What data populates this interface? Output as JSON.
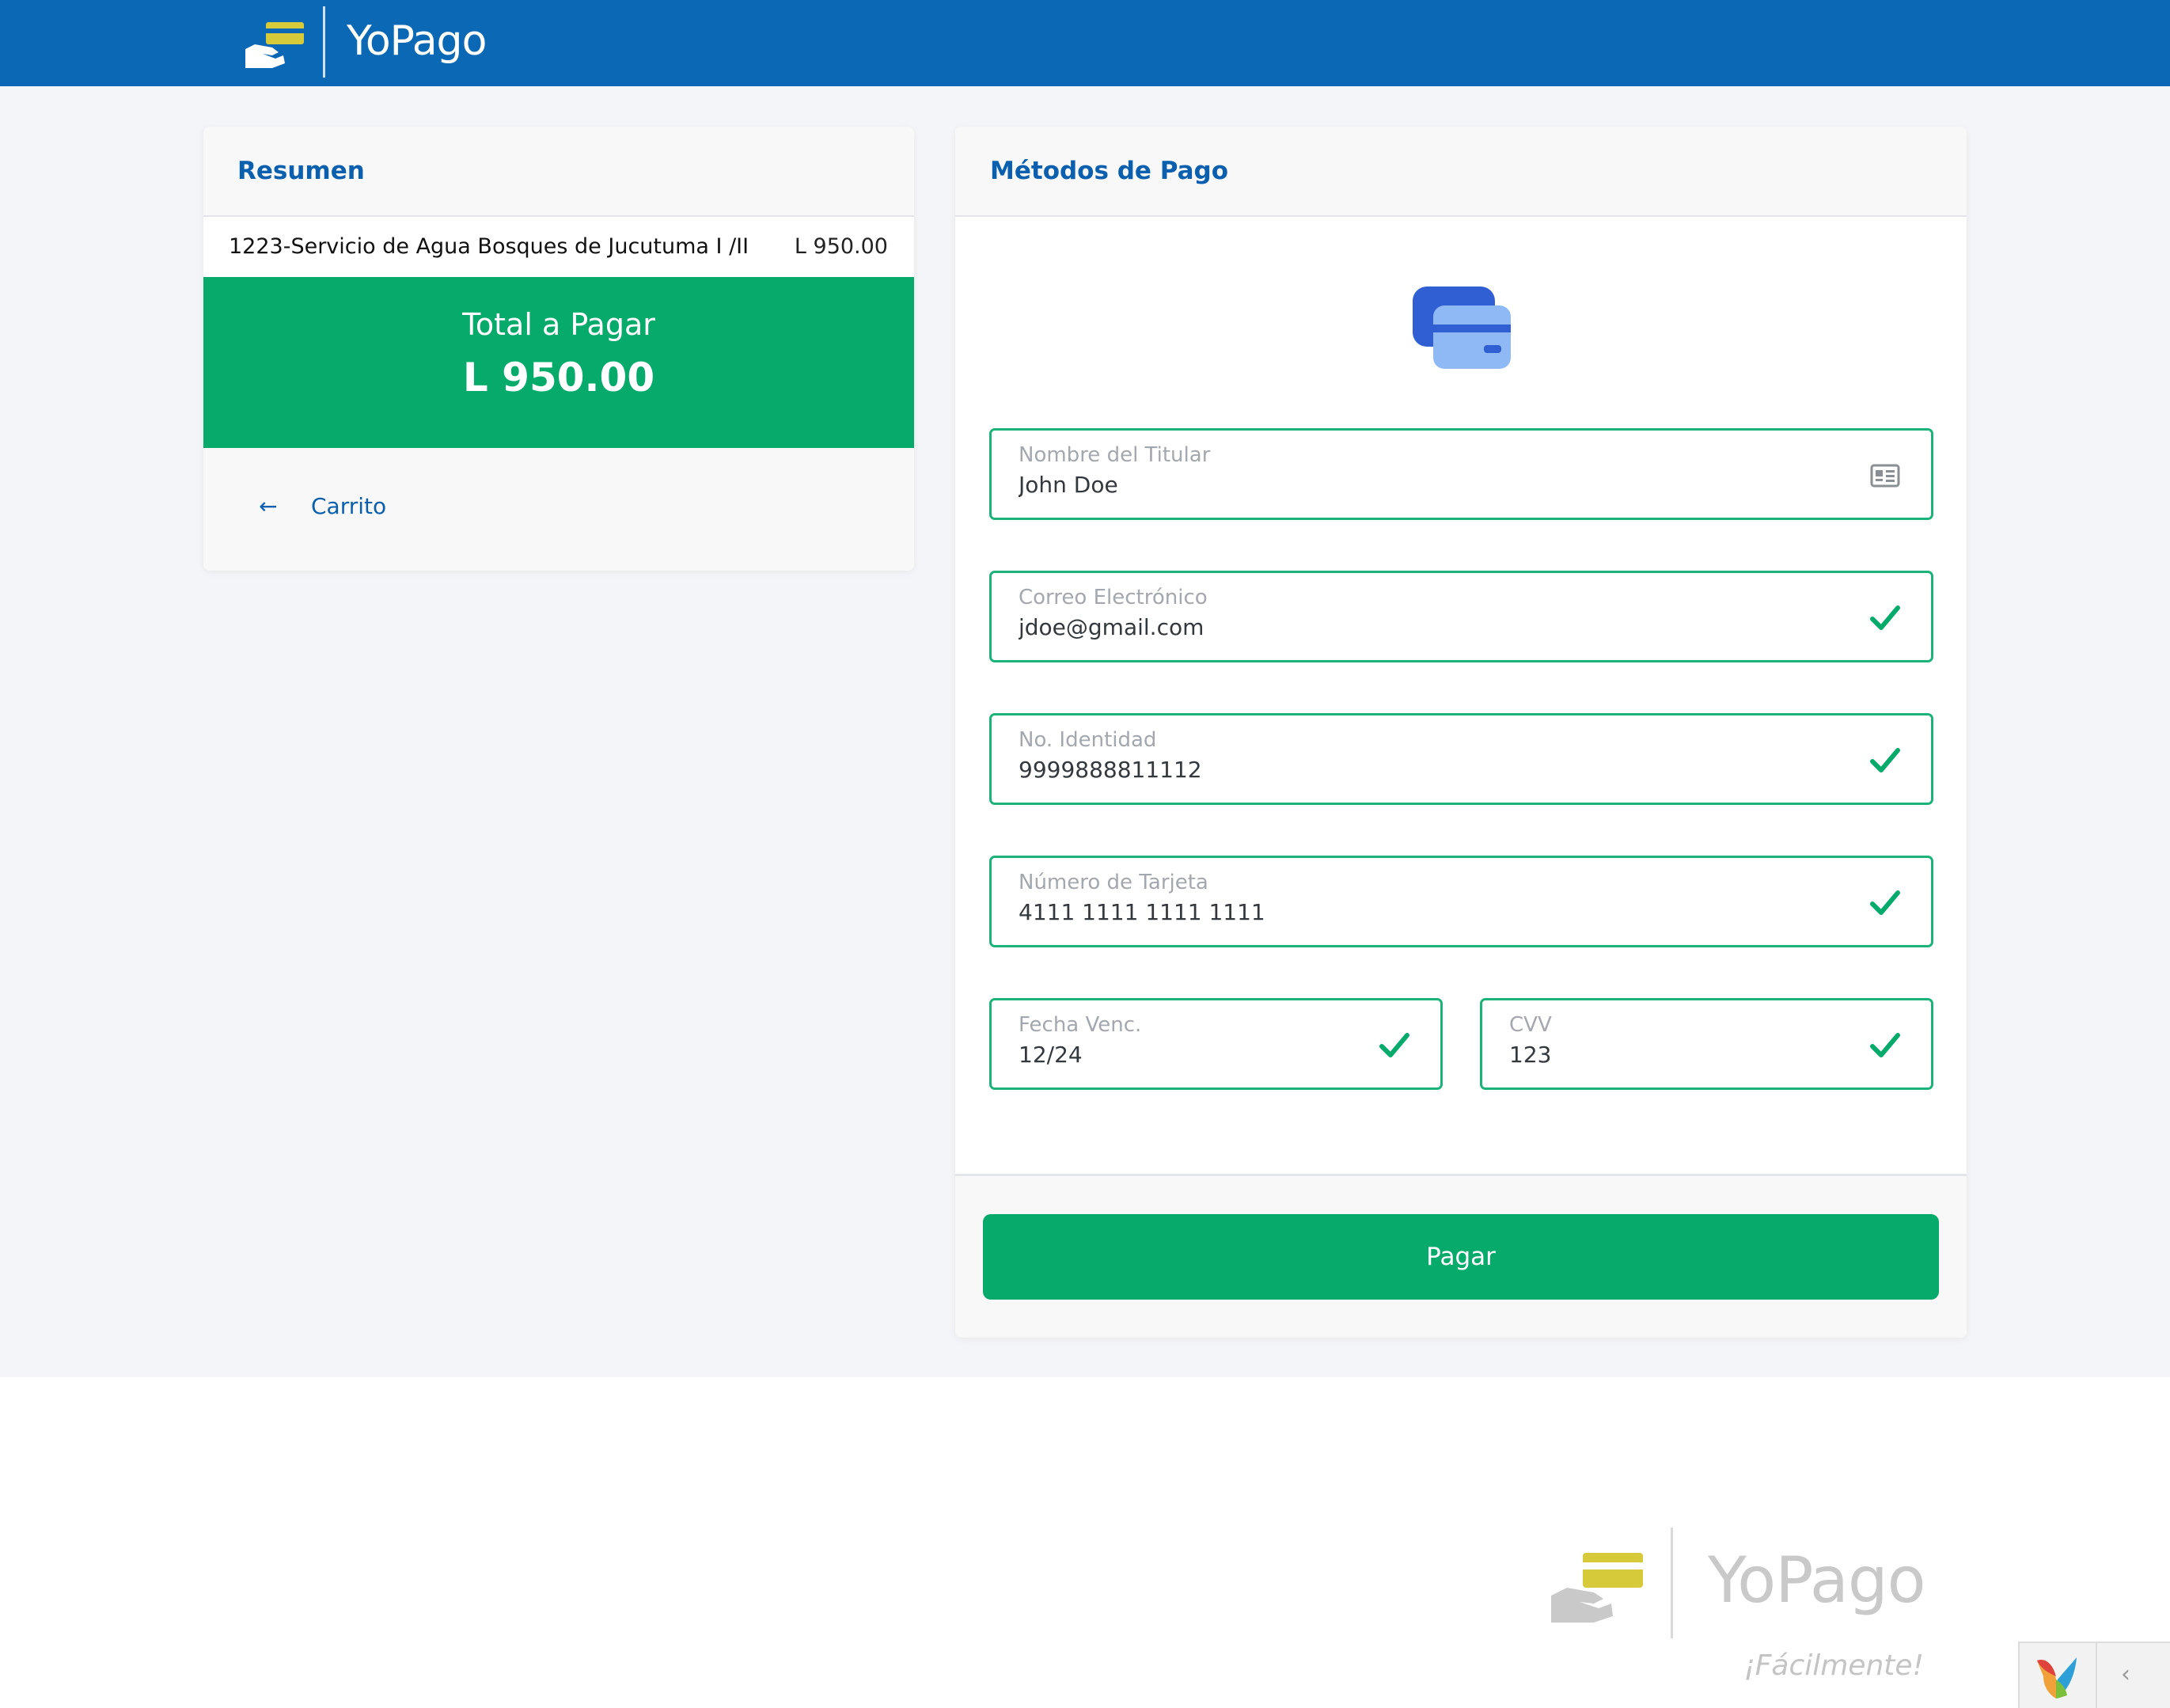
{
  "header": {
    "brand": "YoPago"
  },
  "summary": {
    "title": "Resumen",
    "item": {
      "description": "1223-Servicio de Agua Bosques de Jucutuma I /II",
      "amount": "L 950.00"
    },
    "total_label": "Total a Pagar",
    "total_value": "L 950.00",
    "back_arrow": "←",
    "back_label": "Carrito"
  },
  "payment": {
    "title": "Métodos de Pago",
    "fields": {
      "holder": {
        "label": "Nombre del Titular",
        "value": "John Doe"
      },
      "email": {
        "label": "Correo Electrónico",
        "value": "jdoe@gmail.com"
      },
      "id": {
        "label": "No. Identidad",
        "value": "9999888811112"
      },
      "card": {
        "label": "Número de Tarjeta",
        "value": "4111 1111 1111 1111"
      },
      "expiry": {
        "label": "Fecha Venc.",
        "value": "12/24"
      },
      "cvv": {
        "label": "CVV",
        "value": "123"
      }
    },
    "submit_label": "Pagar"
  },
  "footer": {
    "brand": "YoPago",
    "tagline": "¡Fácilmente!"
  },
  "debug": {
    "toggle": "‹"
  },
  "colors": {
    "header_bg": "#0a68b4",
    "accent_green": "#06ab6b",
    "field_border": "#1bb37a",
    "link_blue": "#0a5fae"
  },
  "icons": {
    "brand": "hand-card-icon",
    "payment_method": "credit-cards-icon",
    "holder_field": "id-card-icon",
    "valid_field": "check-icon",
    "back": "arrow-left-icon",
    "debug": "yii-logo-icon"
  }
}
